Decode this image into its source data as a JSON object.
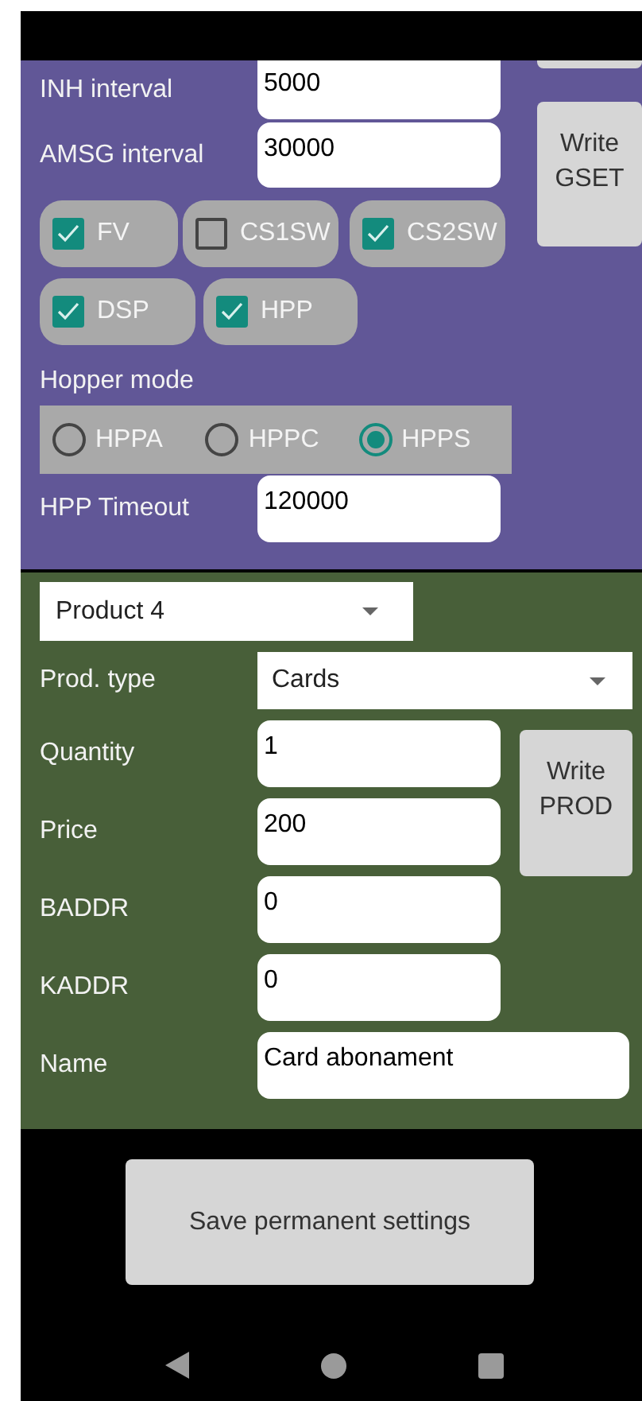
{
  "general": {
    "fields": [
      {
        "label": "INH interval",
        "value": "5000",
        "cut": true
      },
      {
        "label": "AMSG interval",
        "value": "30000",
        "cut": false
      }
    ],
    "write_button": "Write GSET",
    "checkbox_rows": [
      [
        {
          "label": "FV",
          "checked": true
        },
        {
          "label": "CS1SW",
          "checked": false
        },
        {
          "label": "CS2SW",
          "checked": true
        }
      ],
      [
        {
          "label": "DSP",
          "checked": true
        },
        {
          "label": "HPP",
          "checked": true
        }
      ]
    ],
    "hopper_mode": {
      "label": "Hopper mode",
      "options": [
        {
          "label": "HPPA",
          "selected": false
        },
        {
          "label": "HPPC",
          "selected": false
        },
        {
          "label": "HPPS",
          "selected": true
        }
      ]
    },
    "timeout": {
      "label": "HPP Timeout",
      "value": "120000"
    }
  },
  "product": {
    "selector": "Product 4",
    "type": {
      "label": "Prod. type",
      "value": "Cards"
    },
    "fields": [
      {
        "label": "Quantity",
        "value": "1"
      },
      {
        "label": "Price",
        "value": "200"
      },
      {
        "label": "BADDR",
        "value": "0"
      },
      {
        "label": "KADDR",
        "value": "0"
      }
    ],
    "write_button": "Write PROD",
    "name": {
      "label": "Name",
      "value": "Card abonament"
    }
  },
  "save_button": "Save permanent settings"
}
